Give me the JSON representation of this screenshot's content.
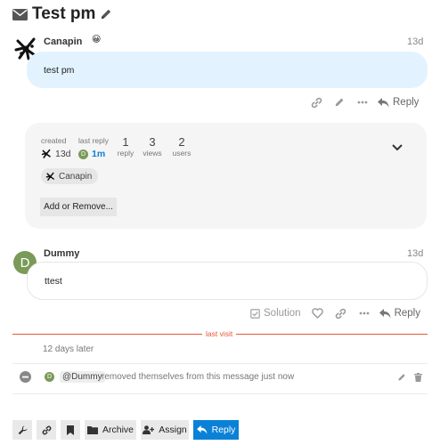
{
  "topic": {
    "title": "Test pm"
  },
  "posts": [
    {
      "username": "Canapin",
      "emoji": "😀",
      "date": "13d",
      "body": "test pm"
    },
    {
      "username": "Dummy",
      "avatar_letter": "D",
      "date": "13d",
      "body": "ttest"
    }
  ],
  "actions": {
    "reply_label": "Reply",
    "solution_label": "Solution"
  },
  "summary": {
    "created_label": "created",
    "created_value": "13d",
    "last_reply_label": "last reply",
    "last_reply_value": "1m",
    "last_reply_avatar": "D",
    "reply_count": "1",
    "reply_label": "reply",
    "views_count": "3",
    "views_label": "views",
    "users_count": "2",
    "users_label": "users",
    "participant_name": "Canapin",
    "add_remove_label": "Add or Remove..."
  },
  "divider": {
    "last_visit_label": "last visit",
    "gap_label": "12 days later"
  },
  "small_action": {
    "avatar_letter": "D",
    "mention": "@Dummy",
    "text": "removed themselves from this message just now"
  },
  "footer": {
    "archive_label": "Archive",
    "assign_label": "Assign",
    "reply_label": "Reply"
  },
  "colors": {
    "accent": "#0a81d6",
    "last_visit": "#e45735",
    "bubble": "#e2f3ff",
    "avatar": "#7a9a58"
  },
  "icons": [
    "envelope-icon",
    "pencil-icon",
    "link-icon",
    "ellipsis-icon",
    "reply-icon",
    "chevron-down-icon",
    "heart-icon",
    "check-square-icon",
    "minus-circle-icon",
    "trash-icon",
    "wrench-icon",
    "bookmark-icon",
    "folder-icon",
    "user-plus-icon"
  ]
}
